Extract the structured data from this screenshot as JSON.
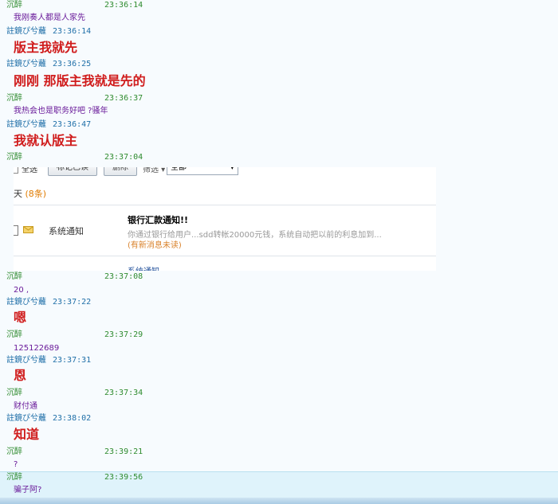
{
  "users": {
    "a": "沉醉",
    "b": "註鏡ぴ兮蘺"
  },
  "messages": [
    {
      "time": "23:36:14",
      "text": "我刚奏人都是人家先"
    },
    {
      "time": "23:36:14",
      "text": "版主我就先"
    },
    {
      "time": "23:36:25",
      "text": "刚刚  那版主我就是先的"
    },
    {
      "time": "23:36:37",
      "text": "我热会也是职务好吧 ?骚年"
    },
    {
      "time": "23:36:47",
      "text": "我就认版主"
    },
    {
      "time": "23:37:04"
    },
    {
      "time": "23:37:08",
      "text": "20 ,"
    },
    {
      "time": "23:37:22",
      "text": "嗯"
    },
    {
      "time": "23:37:29",
      "text": "125122689"
    },
    {
      "time": "23:37:31",
      "text": "恩"
    },
    {
      "time": "23:37:34",
      "text": "财付通"
    },
    {
      "time": "23:38:02",
      "text": "知道"
    },
    {
      "time": "23:39:21",
      "text": "?"
    },
    {
      "time": "23:39:56",
      "text": "骗子阿?"
    }
  ],
  "mail": {
    "toolbar": {
      "all": "全选",
      "mark_read": "标记已读",
      "delete": "删除",
      "filter": "筛选 ▾",
      "filter_value": "全部"
    },
    "section": {
      "label": "天",
      "count": "(8条)"
    },
    "item": {
      "sender": "系统通知",
      "subject": "银行汇款通知!!",
      "preview": "你通过银行给用户...sdd转帐20000元钱，系统自动把以前的利息加到...",
      "status": "(有新消息未读)"
    },
    "next_item": "系统通知"
  },
  "colors": {
    "user_a": "#2e8b2e",
    "user_b": "#1f6fa8",
    "small_text": "#6a1b9a",
    "big_text": "#d01c1c",
    "highlight": "#dff3fb"
  }
}
